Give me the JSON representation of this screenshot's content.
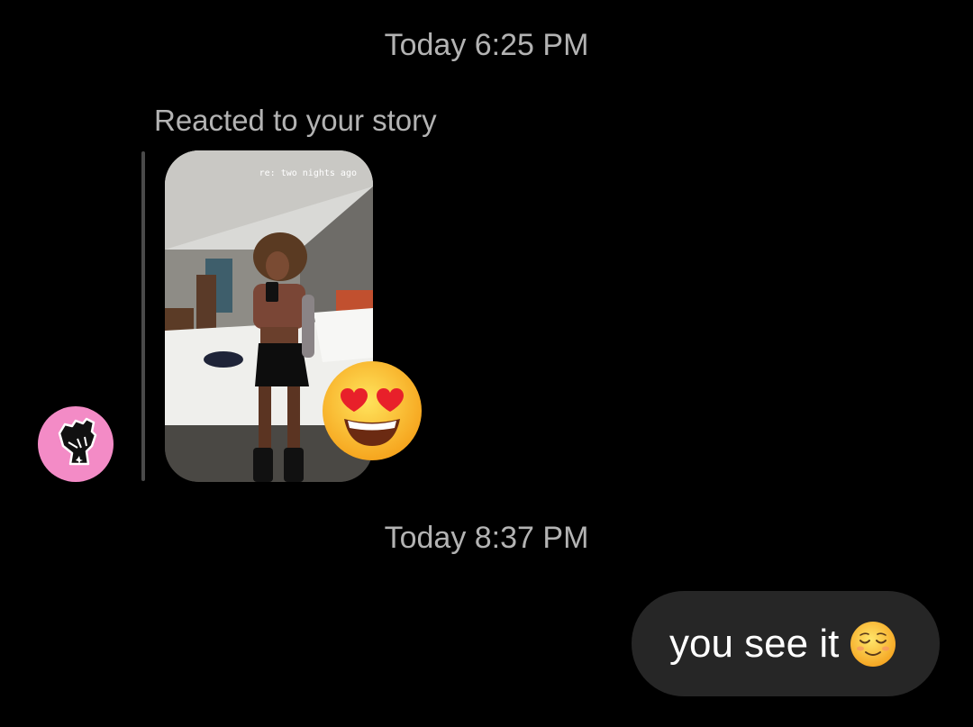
{
  "thread": {
    "timestamp_1": "Today 6:25 PM",
    "timestamp_2": "Today 8:37 PM"
  },
  "story_reply": {
    "label": "Reacted to your story",
    "story_caption": "re: two nights ago",
    "reaction": "heart-eyes-emoji"
  },
  "sender_avatar": {
    "icon": "raised-fist-icon",
    "bg_color": "#f38bc6"
  },
  "outgoing_message": {
    "text": "you see it",
    "emoji": "relieved-face-emoji"
  },
  "colors": {
    "background": "#000000",
    "bubble": "#262626",
    "muted_text": "#b3b3b3"
  }
}
